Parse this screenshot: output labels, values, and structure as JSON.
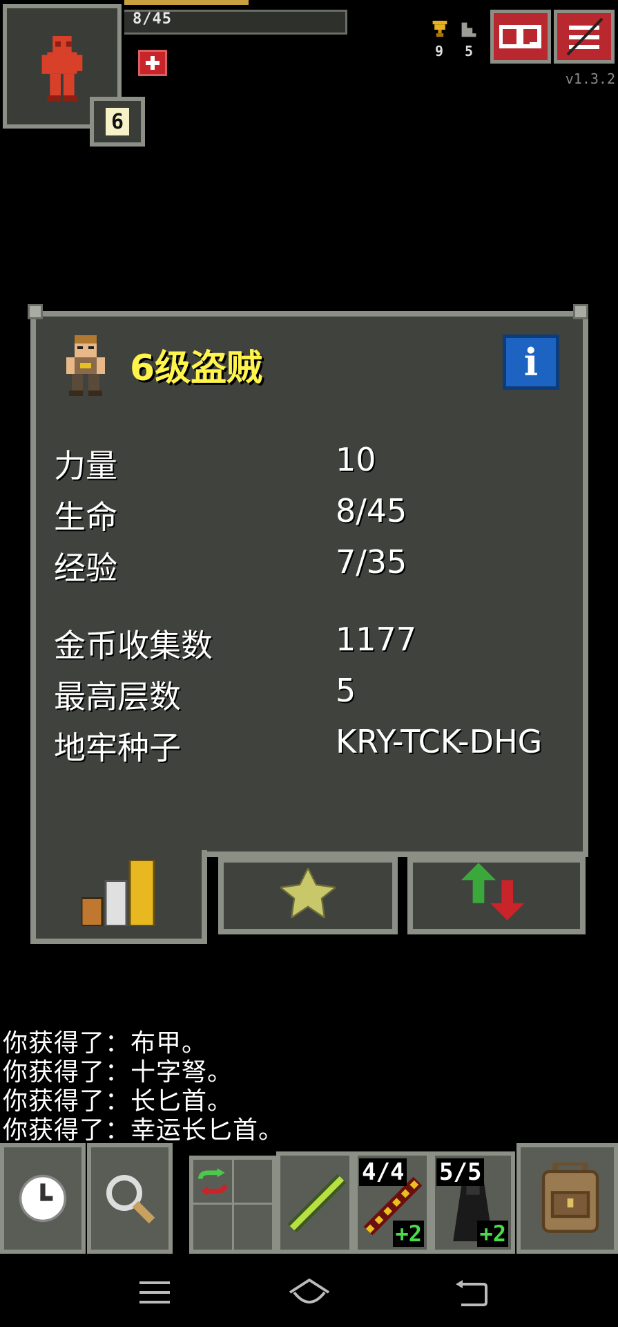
{
  "hud": {
    "hp_text": "8/45",
    "hp_fraction": 0.18,
    "level": "6",
    "challenges_count": "9",
    "depth_count": "5",
    "version": "v1.3.2",
    "icons": {
      "journal": "journal-icon",
      "menu": "menu-icon",
      "trophy": "trophy-icon",
      "depth": "stairs-icon",
      "buff": "healing-buff-icon"
    },
    "colors": {
      "hp_bar": "#c8a040",
      "buff": "#c8242a",
      "top_button": "#b8282e"
    }
  },
  "window": {
    "title": "6级盗贼",
    "info_symbol": "i",
    "stats": [
      {
        "label": "力量",
        "value": "10"
      },
      {
        "label": "生命",
        "value": "8/45"
      },
      {
        "label": "经验",
        "value": "7/35"
      }
    ],
    "records": [
      {
        "label": "金币收集数",
        "value": "1177"
      },
      {
        "label": "最高层数",
        "value": "5"
      },
      {
        "label": "地牢种子",
        "value": "KRY-TCK-DHG"
      }
    ],
    "tabs": [
      {
        "name": "stats",
        "icon": "bar-chart-icon",
        "active": true
      },
      {
        "name": "badges",
        "icon": "star-icon",
        "active": false
      },
      {
        "name": "items",
        "icon": "up-down-arrows-icon",
        "active": false
      }
    ]
  },
  "log": [
    "你获得了：布甲。",
    "你获得了：十字弩。",
    "你获得了：长匕首。",
    "你获得了：幸运长匕首。"
  ],
  "toolbar": {
    "quickslots": [
      {
        "item": "green-wand-icon"
      },
      {
        "item": "red-wand-icon",
        "charges": "4/4",
        "upgrade": "+2"
      },
      {
        "item": "dark-cloak-icon",
        "charges": "5/5",
        "upgrade": "+2"
      }
    ]
  },
  "navbar": {
    "icons": [
      "menu-lines-icon",
      "home-icon",
      "back-icon"
    ]
  }
}
